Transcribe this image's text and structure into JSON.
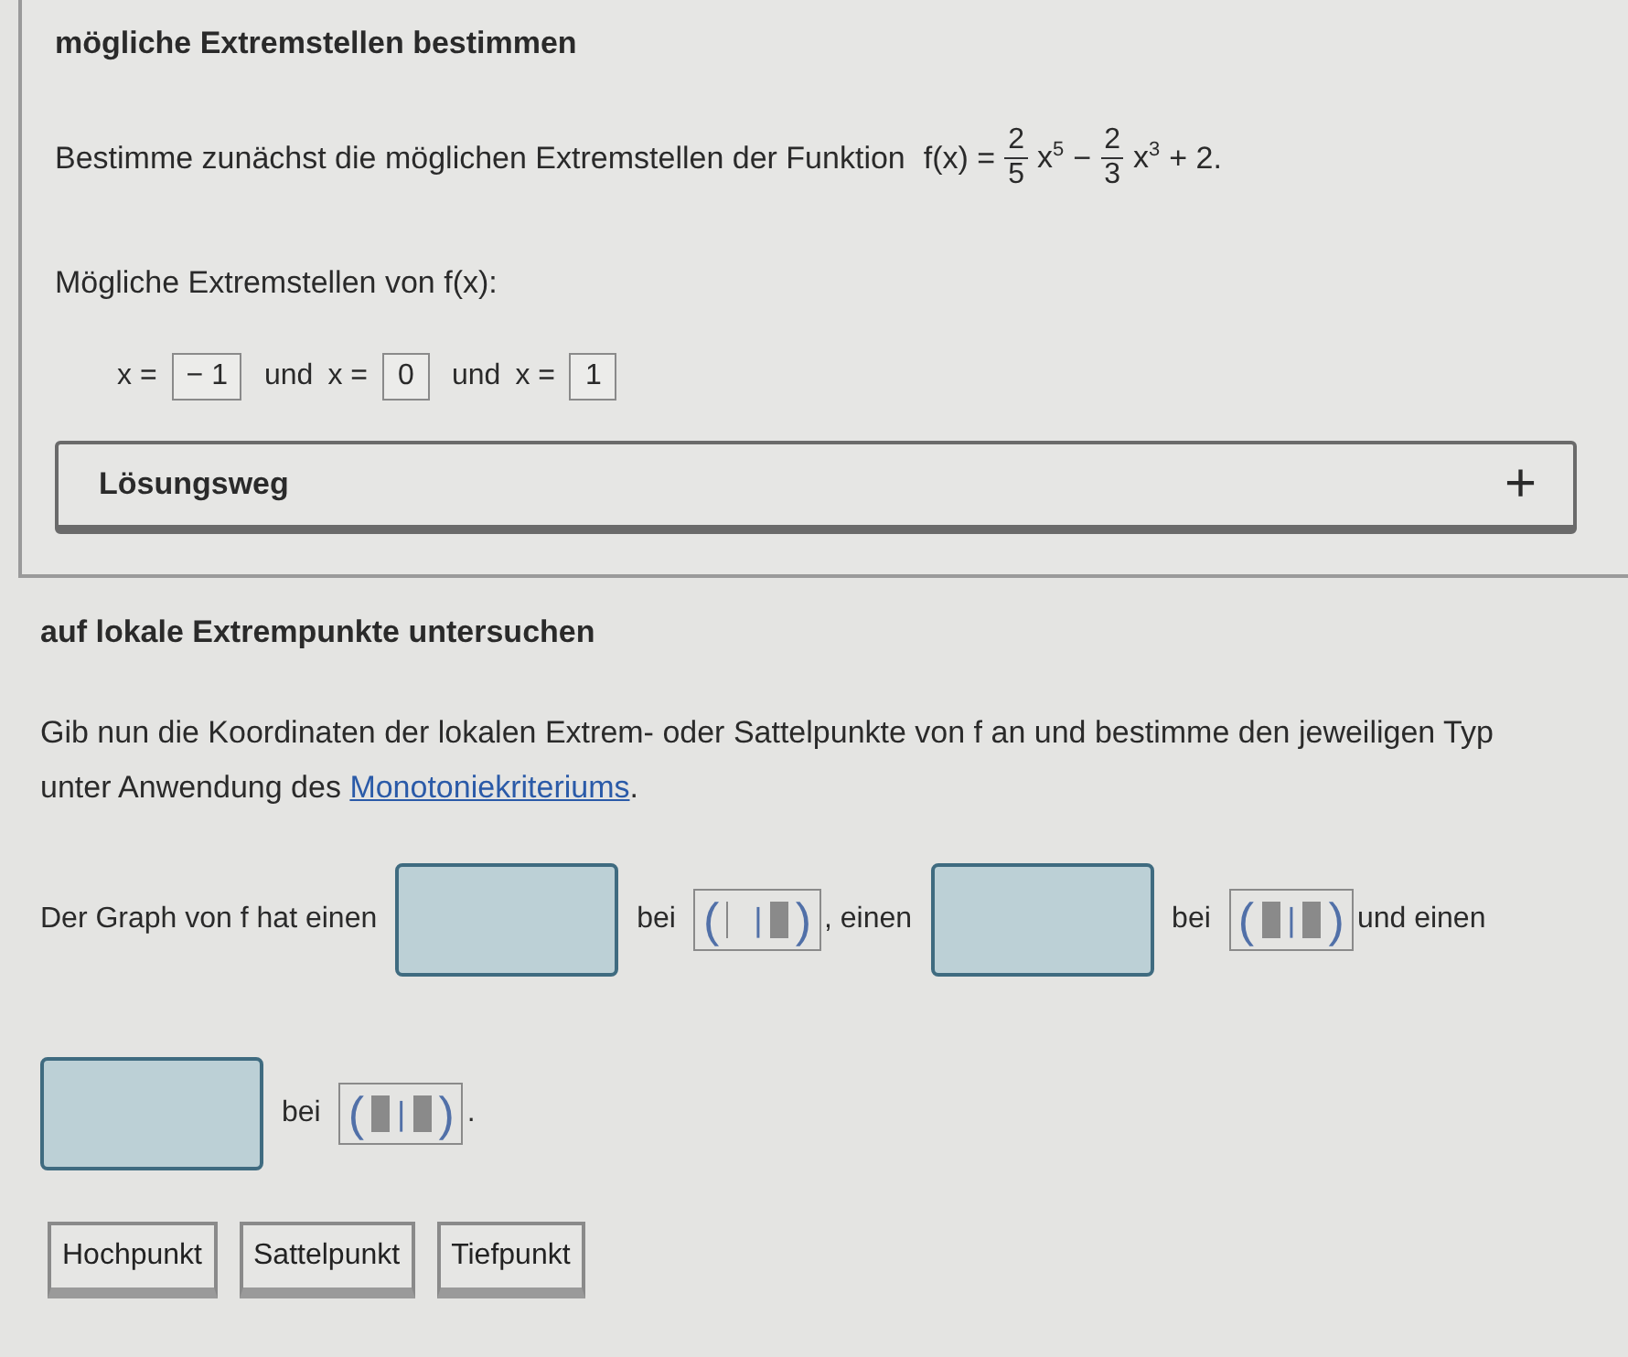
{
  "part1": {
    "title": "mögliche Extremstellen bestimmen",
    "task": "Bestimme zunächst die möglichen Extremstellen der Funktion",
    "formula": {
      "lhs": "f(x) =",
      "terms": [
        {
          "num": "2",
          "den": "5",
          "base": "x",
          "exp": "5"
        },
        {
          "sign": "−",
          "num": "2",
          "den": "3",
          "base": "x",
          "exp": "3"
        }
      ],
      "tail": "+ 2."
    },
    "roots_label": "Mögliche Extremstellen von",
    "roots_fn": "f(x):",
    "roots": [
      {
        "label": "x =",
        "value": "− 1"
      },
      {
        "joiner": "und",
        "label": "x =",
        "value": "0"
      },
      {
        "joiner": "und",
        "label": "x =",
        "value": "1"
      }
    ],
    "solution": {
      "label": "Lösungsweg",
      "toggle": "+",
      "expanded": false
    }
  },
  "part2": {
    "title": "auf lokale Extrempunkte untersuchen",
    "task": "Gib nun die Koordinaten der lokalen Extrem- oder Sattelpunkte von  f an und bestimme den jeweiligen Typ unter Anwendung des",
    "link": "Monotoniekriteriums",
    "task_end": ".",
    "sentence": [
      {
        "kind": "text",
        "text": "Der Graph von  f hat einen"
      },
      {
        "kind": "slot"
      },
      {
        "kind": "text",
        "text": "bei"
      },
      {
        "kind": "coord",
        "open": "(",
        "sep": "|",
        "close": ")",
        "tail": ", einen",
        "first_filled": false
      },
      {
        "kind": "slot"
      },
      {
        "kind": "text",
        "text": "bei"
      },
      {
        "kind": "coord",
        "open": "(",
        "sep": "|",
        "close": ")",
        "tail": "und einen",
        "first_filled": true
      },
      {
        "kind": "break"
      },
      {
        "kind": "slot"
      },
      {
        "kind": "text",
        "text": "bei"
      },
      {
        "kind": "coord",
        "open": "(",
        "sep": "|",
        "close": ")",
        "tail": ".",
        "first_filled": true
      }
    ],
    "choices": [
      "Hochpunkt",
      "Sattelpunkt",
      "Tiefpunkt"
    ]
  }
}
